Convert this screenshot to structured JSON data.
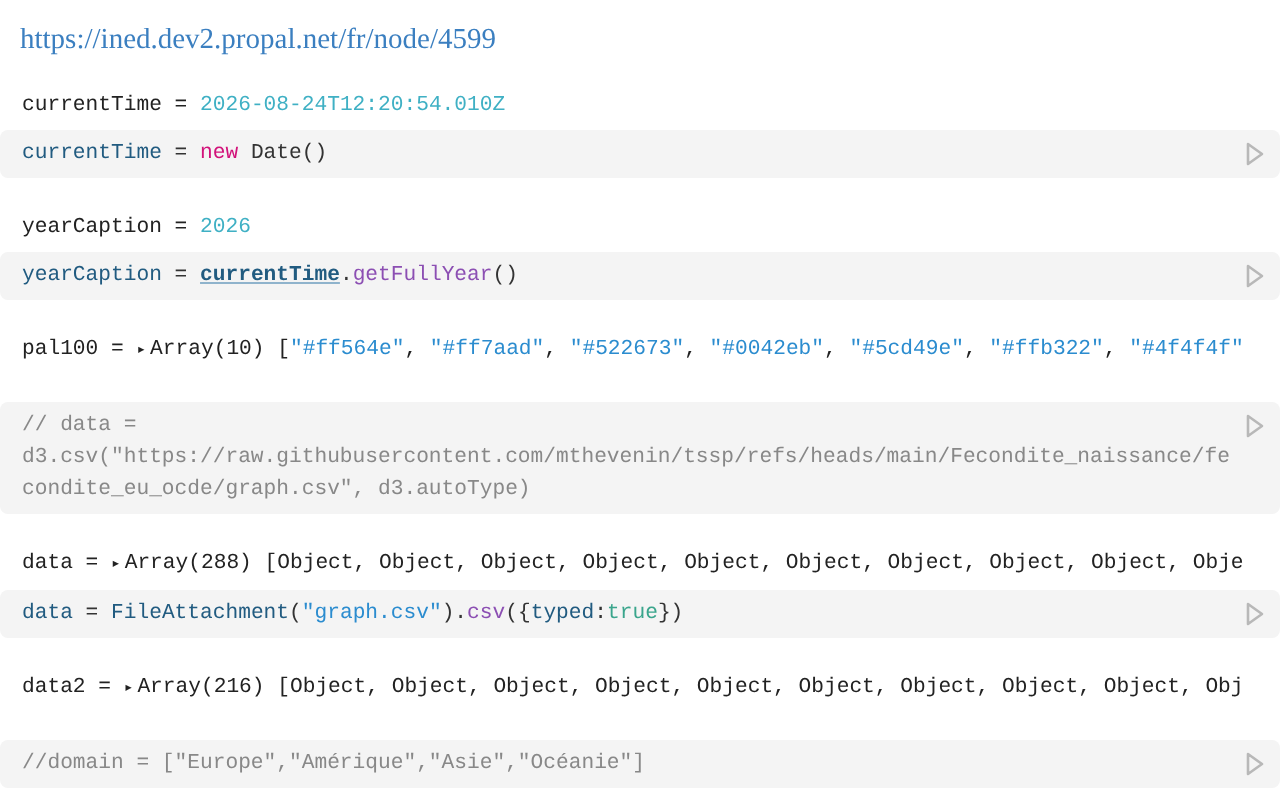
{
  "url": "https://ined.dev2.propal.net/fr/node/4599",
  "cells": [
    {
      "output": [
        {
          "kind": "name",
          "text": "currentTime = "
        },
        {
          "kind": "num",
          "text": "2026-08-24T12:20:54.010Z"
        }
      ],
      "code": [
        [
          {
            "kind": "var",
            "text": "currentTime"
          },
          {
            "kind": "plain",
            "text": " = "
          },
          {
            "kind": "kw",
            "text": "new"
          },
          {
            "kind": "plain",
            "text": " Date()"
          }
        ]
      ]
    },
    {
      "output": [
        {
          "kind": "name",
          "text": "yearCaption = "
        },
        {
          "kind": "num",
          "text": "2026"
        }
      ],
      "code": [
        [
          {
            "kind": "var",
            "text": "yearCaption"
          },
          {
            "kind": "plain",
            "text": " = "
          },
          {
            "kind": "ref",
            "text": "currentTime"
          },
          {
            "kind": "plain",
            "text": "."
          },
          {
            "kind": "method",
            "text": "getFullYear"
          },
          {
            "kind": "plain",
            "text": "()"
          }
        ]
      ]
    },
    {
      "output": [
        {
          "kind": "name",
          "text": "pal100 = "
        },
        {
          "kind": "toggle",
          "text": "▸"
        },
        {
          "kind": "name",
          "text": "Array(10) ["
        },
        {
          "kind": "str",
          "text": "\"#ff564e\""
        },
        {
          "kind": "name",
          "text": ", "
        },
        {
          "kind": "str",
          "text": "\"#ff7aad\""
        },
        {
          "kind": "name",
          "text": ", "
        },
        {
          "kind": "str",
          "text": "\"#522673\""
        },
        {
          "kind": "name",
          "text": ", "
        },
        {
          "kind": "str",
          "text": "\"#0042eb\""
        },
        {
          "kind": "name",
          "text": ", "
        },
        {
          "kind": "str",
          "text": "\"#5cd49e\""
        },
        {
          "kind": "name",
          "text": ", "
        },
        {
          "kind": "str",
          "text": "\"#ffb322\""
        },
        {
          "kind": "name",
          "text": ", "
        },
        {
          "kind": "str",
          "text": "\"#4f4f4f\""
        }
      ]
    },
    {
      "code": [
        [
          {
            "kind": "comment",
            "text": "// data ="
          }
        ],
        [
          {
            "kind": "comment",
            "text": "d3.csv(\"https://raw.githubusercontent.com/mthevenin/tssp/refs/heads/main/Fecondite_naissance/fe"
          }
        ],
        [
          {
            "kind": "comment",
            "text": "condite_eu_ocde/graph.csv\", d3.autoType)"
          }
        ]
      ]
    },
    {
      "output": [
        {
          "kind": "name",
          "text": "data = "
        },
        {
          "kind": "toggle",
          "text": "▸"
        },
        {
          "kind": "name",
          "text": "Array(288) [Object, Object, Object, Object, Object, Object, Object, Object, Object, Obje"
        }
      ],
      "code": [
        [
          {
            "kind": "var",
            "text": "data"
          },
          {
            "kind": "plain",
            "text": " = "
          },
          {
            "kind": "var",
            "text": "FileAttachment"
          },
          {
            "kind": "plain",
            "text": "("
          },
          {
            "kind": "str",
            "text": "\"graph.csv\""
          },
          {
            "kind": "plain",
            "text": ")."
          },
          {
            "kind": "method",
            "text": "csv"
          },
          {
            "kind": "plain",
            "text": "({"
          },
          {
            "kind": "var",
            "text": "typed"
          },
          {
            "kind": "plain",
            "text": ":"
          },
          {
            "kind": "bool",
            "text": "true"
          },
          {
            "kind": "plain",
            "text": "})"
          }
        ]
      ]
    },
    {
      "output": [
        {
          "kind": "name",
          "text": "data2 = "
        },
        {
          "kind": "toggle",
          "text": "▸"
        },
        {
          "kind": "name",
          "text": "Array(216) [Object, Object, Object, Object, Object, Object, Object, Object, Object, Obj"
        }
      ]
    },
    {
      "code": [
        [
          {
            "kind": "comment",
            "text": "//domain = [\"Europe\",\"Amérique\",\"Asie\",\"Océanie\"]"
          }
        ]
      ]
    }
  ]
}
